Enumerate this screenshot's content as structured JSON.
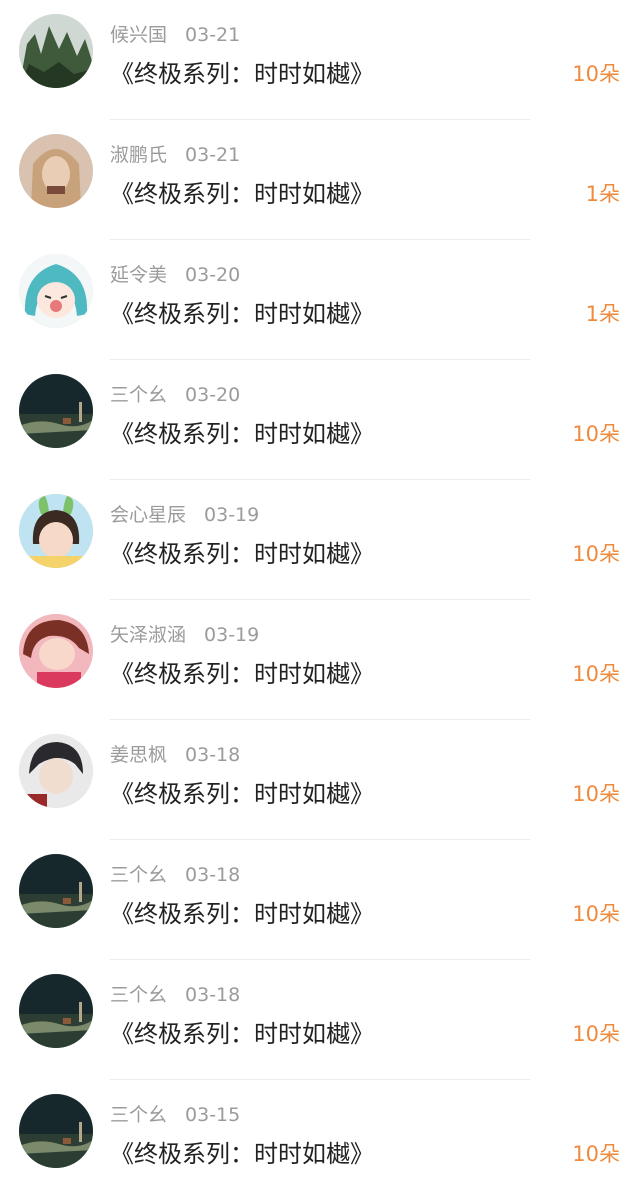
{
  "gift_list": [
    {
      "user": "候兴国",
      "date": "03-21",
      "title": "《终极系列：时时如樾》",
      "count": "10朵",
      "avatar": "mountain-landscape-avatar"
    },
    {
      "user": "淑鹏氏",
      "date": "03-21",
      "title": "《终极系列：时时如樾》",
      "count": "1朵",
      "avatar": "long-hair-girl-avatar"
    },
    {
      "user": "延令美",
      "date": "03-20",
      "title": "《终极系列：时时如樾》",
      "count": "1朵",
      "avatar": "anime-teal-hair-avatar"
    },
    {
      "user": "三个幺",
      "date": "03-20",
      "title": "《终极系列：时时如樾》",
      "count": "10朵",
      "avatar": "dark-field-scene-avatar"
    },
    {
      "user": "会心星辰",
      "date": "03-19",
      "title": "《终极系列：时时如樾》",
      "count": "10朵",
      "avatar": "child-with-bunny-ears-avatar"
    },
    {
      "user": "矢泽淑涵",
      "date": "03-19",
      "title": "《终极系列：时时如樾》",
      "count": "10朵",
      "avatar": "pink-photo-girl-avatar"
    },
    {
      "user": "姜思枫",
      "date": "03-18",
      "title": "《终极系列：时时如樾》",
      "count": "10朵",
      "avatar": "boy-portrait-avatar"
    },
    {
      "user": "三个幺",
      "date": "03-18",
      "title": "《终极系列：时时如樾》",
      "count": "10朵",
      "avatar": "dark-field-scene-avatar"
    },
    {
      "user": "三个幺",
      "date": "03-18",
      "title": "《终极系列：时时如樾》",
      "count": "10朵",
      "avatar": "dark-field-scene-avatar"
    },
    {
      "user": "三个幺",
      "date": "03-15",
      "title": "《终极系列：时时如樾》",
      "count": "10朵",
      "avatar": "dark-field-scene-avatar"
    }
  ],
  "colors": {
    "count": "#f08a3c",
    "meta": "#9b9b9b",
    "title": "#222222"
  }
}
